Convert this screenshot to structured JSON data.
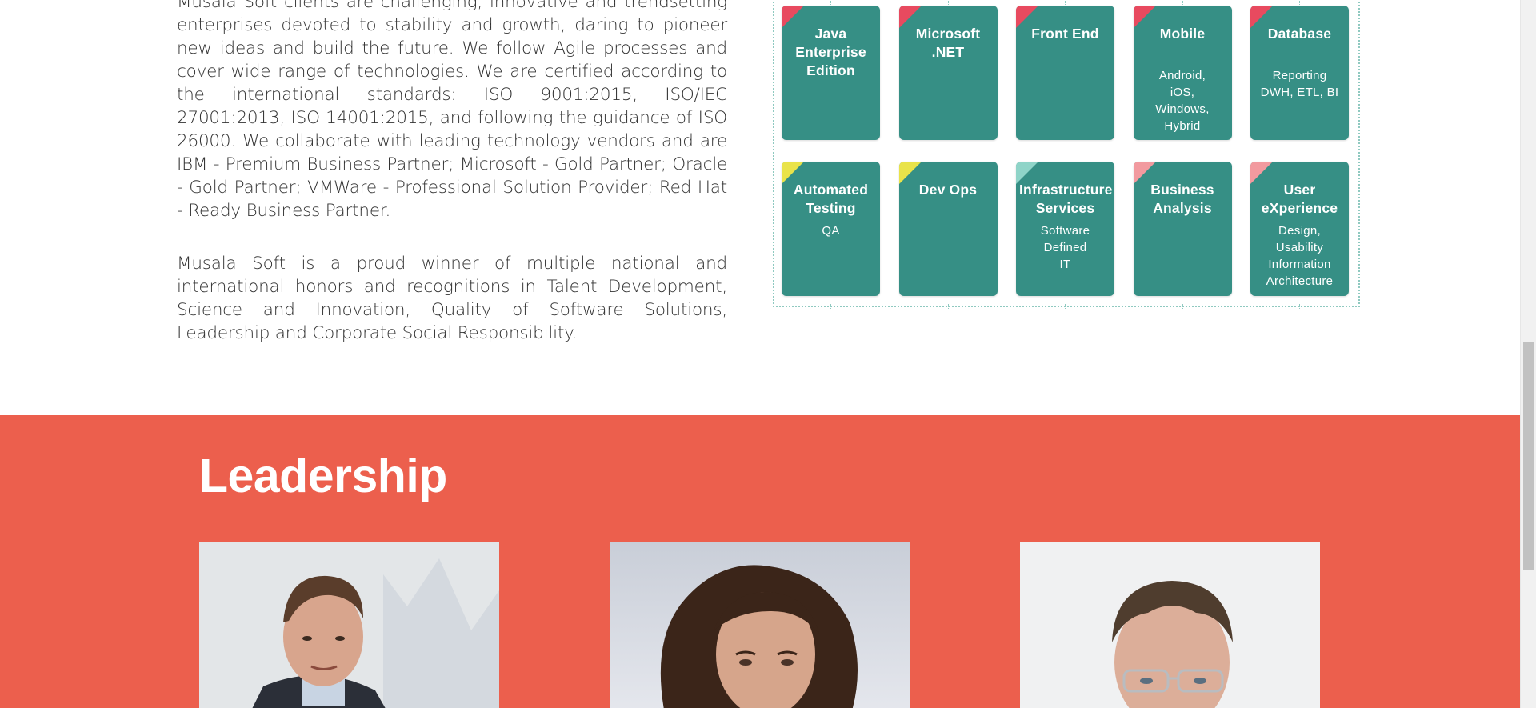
{
  "about": {
    "paragraph_1": "Musala Soft clients are challenging, innovative and trendsetting enterprises devoted to stability and growth, daring to pioneer new ideas and build the future. We follow Agile processes and cover wide range of technologies. We are certified according to the international standards: ISO 9001:2015, ISO/IEC 27001:2013, ISO 14001:2015, and following the guidance of ISO 26000. We collaborate with leading technology vendors and are IBM - Premium Business Partner; Microsoft - Gold Partner; Oracle - Gold Partner; VMWare - Professional Solution Provider; Red Hat - Ready Business Partner.",
    "paragraph_2": "Musala Soft is a proud winner of multiple national and international honors and recognitions in Talent Development, Science and Innovation, Quality of Software Solutions, Leadership and Corporate Social Responsibility."
  },
  "expertise": {
    "tiles": [
      {
        "title": "Java Enterprise Edition",
        "sub": "",
        "corner": "#e84a5f"
      },
      {
        "title": "Microsoft .NET",
        "sub": "",
        "corner": "#e84a5f"
      },
      {
        "title": "Front End",
        "sub": "",
        "corner": "#e84a5f"
      },
      {
        "title": "Mobile",
        "sub": "Android, iOS, Windows, Hybrid",
        "corner": "#e84a5f"
      },
      {
        "title": "Database",
        "sub": "Reporting DWH, ETL, BI",
        "corner": "#e84a5f"
      },
      {
        "title": "Automated Testing",
        "sub": "QA",
        "corner": "#e9e34a"
      },
      {
        "title": "Dev Ops",
        "sub": "",
        "corner": "#e9e34a"
      },
      {
        "title": "Infrastructure Services",
        "sub": "Software Defined IT",
        "corner": "#8fd4c8"
      },
      {
        "title": "Business Analysis",
        "sub": "",
        "corner": "#f29a9f"
      },
      {
        "title": "User eXperience",
        "sub": "Design, Usability Information Architecture",
        "corner": "#f29a9f"
      }
    ]
  },
  "leadership": {
    "heading": "Leadership",
    "people": [
      {
        "photo": "leader-photo-1"
      },
      {
        "photo": "leader-photo-2"
      },
      {
        "photo": "leader-photo-3"
      }
    ]
  },
  "colors": {
    "teal_tile": "#368f85",
    "leadership_bg": "#ec5f4d",
    "text": "#333333"
  }
}
